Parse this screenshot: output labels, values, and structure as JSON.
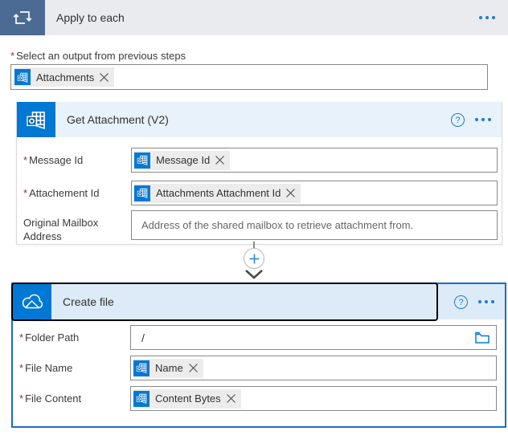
{
  "required_marker": "*",
  "icons": {
    "help_glyph": "?"
  },
  "scope": {
    "title": "Apply to each",
    "select_output_label": "Select an output from previous steps",
    "output_token": "Attachments"
  },
  "get_attachment": {
    "title": "Get Attachment (V2)",
    "message_id": {
      "label": "Message Id",
      "token": "Message Id"
    },
    "attachment_id": {
      "label": "Attachement Id",
      "token": "Attachments Attachment Id"
    },
    "mailbox": {
      "label": "Original Mailbox Address",
      "placeholder": "Address of the shared mailbox to retrieve attachment from."
    }
  },
  "create_file": {
    "title": "Create file",
    "folder_path": {
      "label": "Folder Path",
      "value": "/"
    },
    "file_name": {
      "label": "File Name",
      "token": "Name"
    },
    "file_content": {
      "label": "File Content",
      "token": "Content Bytes"
    }
  },
  "colors": {
    "scope_icon_bg": "#4C6B94",
    "scope_header_bg": "#E9EBEE",
    "connector_brand_blue": "#0078D4",
    "outlook_card_header_bg": "#E7F2FB",
    "onedrive_card_header_bg": "#DDEBF8",
    "selected_card_border": "#1B6EC2",
    "accent_blue": "#1F7ACD",
    "required_red": "#A4262C"
  }
}
